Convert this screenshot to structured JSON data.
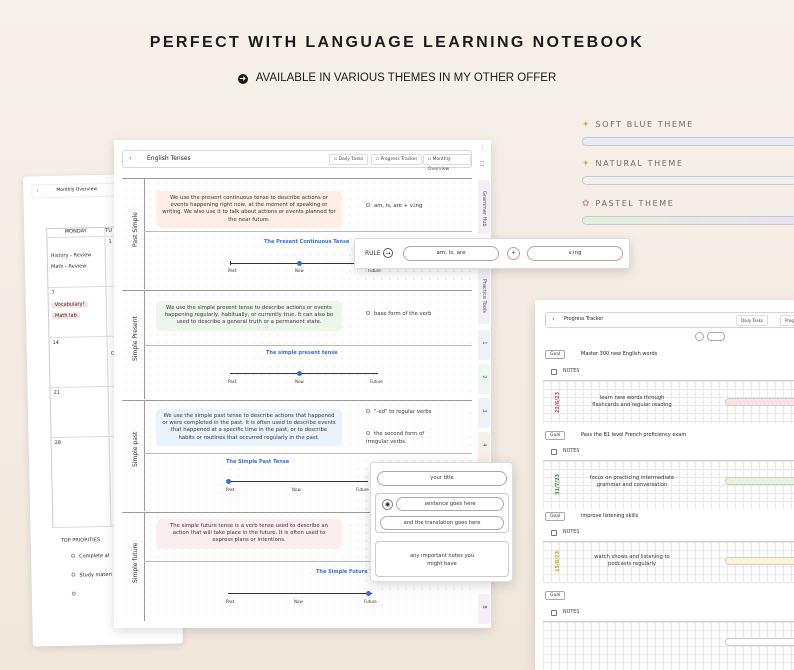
{
  "hero": {
    "title": "PERFECT WITH LANGUAGE LEARNING NOTEBOOK",
    "subtitle": "AVAILABLE IN VARIOUS THEMES IN MY OTHER OFFER"
  },
  "themes": [
    {
      "name": "SOFT BLUE THEME",
      "icon": "sparkle-icon",
      "color": "#e6edf9"
    },
    {
      "name": "NATURAL THEME",
      "icon": "sparkle-icon",
      "color": "#eef0ef"
    },
    {
      "name": "PASTEL THEME",
      "icon": "flower-icon",
      "color": "#e3f1dc"
    }
  ],
  "monthly": {
    "title": "Monthly Overview",
    "days": [
      "MONDAY",
      "TU"
    ],
    "numbers": [
      "1",
      "7",
      "14",
      "21",
      "28"
    ],
    "events": [
      "History - Review",
      "Math - Review",
      "Vocabulary!",
      "Math lab",
      "C"
    ],
    "priorities_title": "TOP PRIORITIES",
    "priorities": [
      "Complete al",
      "Study materi",
      ""
    ]
  },
  "main": {
    "title": "English Tenses",
    "tabs": [
      "Daily Tasks",
      "Progress Tracker",
      "Monthly Overview"
    ],
    "side_tabs": [
      "Grammar Hub",
      "Practice Tools",
      "1",
      "2",
      "3",
      "4",
      "5",
      "6",
      "7",
      "8"
    ],
    "sections": [
      {
        "label": "Past Simple",
        "desc": "We use the present continuous tense to describe actions or events happening right now, at the moment of speaking or writing. We also use it to talk about actions or events planned for the near future.",
        "rules": [
          "am, is, are + v.ing"
        ],
        "timeline_title": "The Present Continuous Tense",
        "timeline_labels": [
          "Past",
          "Now",
          "Future"
        ]
      },
      {
        "label": "Simple Present",
        "desc": "We use the simple present tense to describe actions or events happening regularly, habitually, or currently true. It can also be used to describe a general truth or a permanent state.",
        "rules": [
          "base form of the verb"
        ],
        "timeline_title": "The simple present tense",
        "timeline_labels": [
          "Past",
          "Now",
          "Future"
        ]
      },
      {
        "label": "Simple past",
        "desc": "We use the simple past tense to describe actions that happened or were completed in the past. It is often used to describe events that happened at a specific time in the past, or to describe habits or routines that occurred regularly in the past.",
        "rules": [
          "\"-ed\" to regular verbs",
          "the second form of irregular verbs."
        ],
        "timeline_title": "The Simple Past Tense",
        "timeline_labels": [
          "Past",
          "Now",
          "Future"
        ]
      },
      {
        "label": "Simple future",
        "desc": "The simple future tense is a verb tense used to describe an action that will take place in the future. It is often used to express plans or intentions.",
        "rules": [],
        "timeline_title": "The Simple Future Ten",
        "timeline_labels": [
          "Past",
          "Now",
          "Future"
        ]
      }
    ]
  },
  "rule_popup": {
    "label": "RULE",
    "left": "am, is, are",
    "plus": "+",
    "right": "v.ing"
  },
  "title_popup": {
    "title": "your title",
    "sentence": "sentence goes here",
    "translation": "and the translation goes here",
    "notes": "any important notes you might have"
  },
  "tracker": {
    "title": "Progress Tracker",
    "tabs": [
      "Daily Tasks",
      "Progr"
    ],
    "goal_label": "Goal",
    "notes_label": "NOTES",
    "goals": [
      {
        "text": "Master 300 new English words",
        "task": "learn new words through flashcards and regular reading",
        "date": "22/6/23",
        "date_color": "#d04a4a"
      },
      {
        "text": "Pass the B1 level French proficiency exam",
        "task": "focus on practicing intermediate grammar and conversation",
        "date": "31/7/23",
        "date_color": "#3a8a3a"
      },
      {
        "text": "improve listening skills",
        "task": "watch shows and listening to podcasts regularly",
        "date": "15/8/23",
        "date_color": "#d0a020"
      },
      {
        "text": "",
        "task": "",
        "date": "",
        "date_color": "#999"
      }
    ]
  }
}
